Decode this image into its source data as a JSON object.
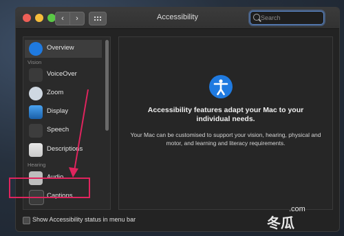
{
  "window": {
    "title": "Accessibility"
  },
  "search": {
    "placeholder": "Search"
  },
  "sidebar": {
    "sections": [
      "Vision",
      "Hearing"
    ],
    "items": [
      {
        "label": "Overview",
        "icon": "accessibility-icon"
      },
      {
        "label": "VoiceOver",
        "icon": "voiceover-icon"
      },
      {
        "label": "Zoom",
        "icon": "zoom-icon"
      },
      {
        "label": "Display",
        "icon": "display-icon"
      },
      {
        "label": "Speech",
        "icon": "speech-icon"
      },
      {
        "label": "Descriptions",
        "icon": "descriptions-icon"
      },
      {
        "label": "Audio",
        "icon": "audio-icon"
      },
      {
        "label": "Captions",
        "icon": "captions-icon"
      }
    ],
    "selected": "Overview",
    "highlighted": "Captions"
  },
  "main": {
    "headline": "Accessibility features adapt your Mac to your individual needs.",
    "description": "Your Mac can be customised to support your vision, hearing, physical and motor, and learning and literacy requirements."
  },
  "footer": {
    "status_label": "Show Accessibility status in menu bar"
  },
  "watermark": {
    "text": "冬瓜",
    "sub": ".com"
  },
  "colors": {
    "accent": "#1f7ae0",
    "highlight": "#e0245e"
  }
}
